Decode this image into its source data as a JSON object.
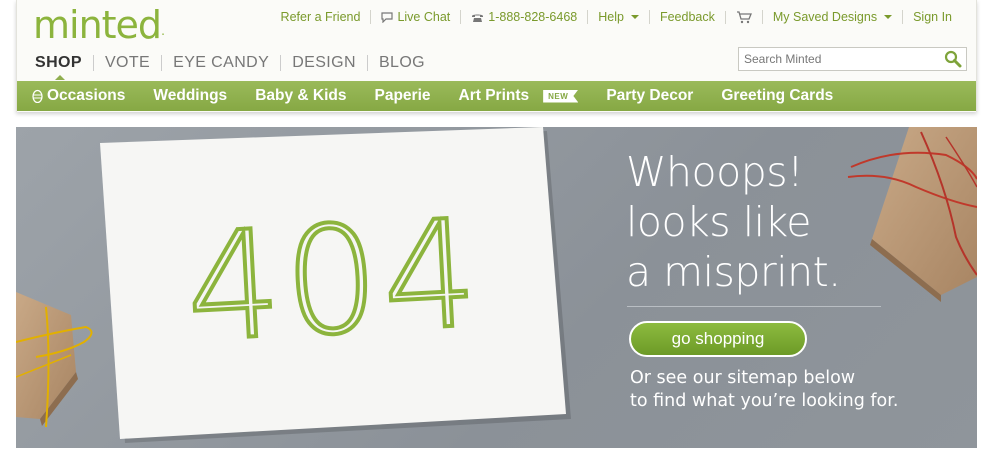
{
  "brand": {
    "logo_text": "minted",
    "logo_dot": "."
  },
  "util_nav": [
    {
      "label": "Refer a Friend"
    },
    {
      "label": "Live Chat"
    },
    {
      "label": "1-888-828-6468"
    },
    {
      "label": "Help"
    },
    {
      "label": "Feedback"
    },
    {
      "label": ""
    },
    {
      "label": "My Saved Designs"
    },
    {
      "label": "Sign In"
    }
  ],
  "main_nav": [
    "SHOP",
    "VOTE",
    "EYE CANDY",
    "DESIGN",
    "BLOG"
  ],
  "search": {
    "placeholder": "Search Minted"
  },
  "categories": [
    "Occasions",
    "Weddings",
    "Baby & Kids",
    "Paperie",
    "Art Prints",
    "Party Decor",
    "Greeting Cards"
  ],
  "new_badge": "NEW",
  "hero": {
    "error_code": "404",
    "headline_lines": [
      "Whoops!",
      "looks like",
      "a misprint."
    ],
    "button_label": "go shopping",
    "sitemap_lines": [
      "Or see our sitemap below",
      "to find what you’re looking for."
    ]
  },
  "colors": {
    "brand_green": "#8cb43d",
    "nav_bar": "#8fae4e",
    "hero_bg": "#959ba1"
  }
}
